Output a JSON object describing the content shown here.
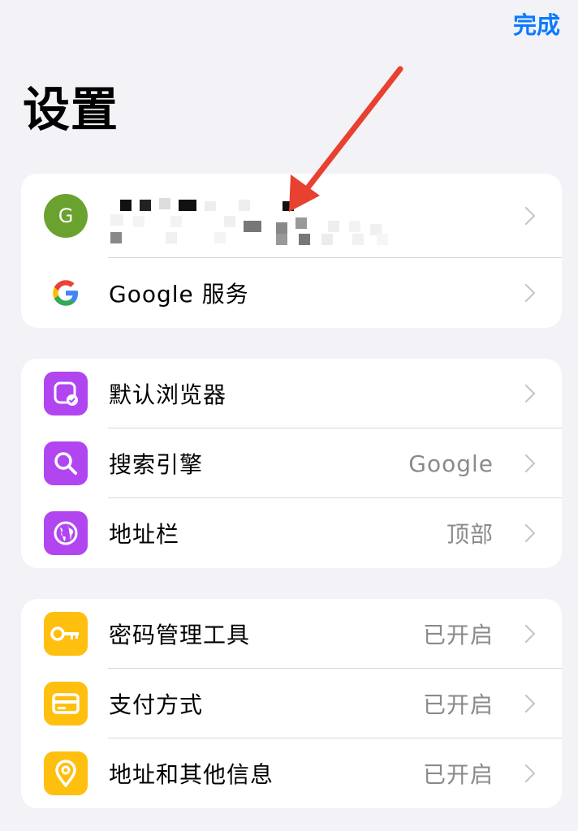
{
  "header": {
    "done_label": "完成",
    "title": "设置"
  },
  "account": {
    "avatar_letter": "G",
    "google_services_label": "Google 服务"
  },
  "browser_group": {
    "items": [
      {
        "label": "默认浏览器",
        "value": "",
        "icon": "default-browser-icon",
        "color": "#b146f0"
      },
      {
        "label": "搜索引擎",
        "value": "Google",
        "icon": "search-icon",
        "color": "#b146f0"
      },
      {
        "label": "地址栏",
        "value": "顶部",
        "icon": "globe-icon",
        "color": "#b146f0"
      }
    ]
  },
  "autofill_group": {
    "items": [
      {
        "label": "密码管理工具",
        "value": "已开启",
        "icon": "key-icon",
        "color": "#ffbf0f"
      },
      {
        "label": "支付方式",
        "value": "已开启",
        "icon": "credit-card-icon",
        "color": "#ffbf0f"
      },
      {
        "label": "地址和其他信息",
        "value": "已开启",
        "icon": "location-pin-icon",
        "color": "#ffbf0f"
      }
    ]
  },
  "colors": {
    "accent": "#0a7aff",
    "purple": "#b146f0",
    "yellow": "#ffbf0f",
    "arrow": "#e8412f",
    "avatar": "#6aa22f"
  }
}
